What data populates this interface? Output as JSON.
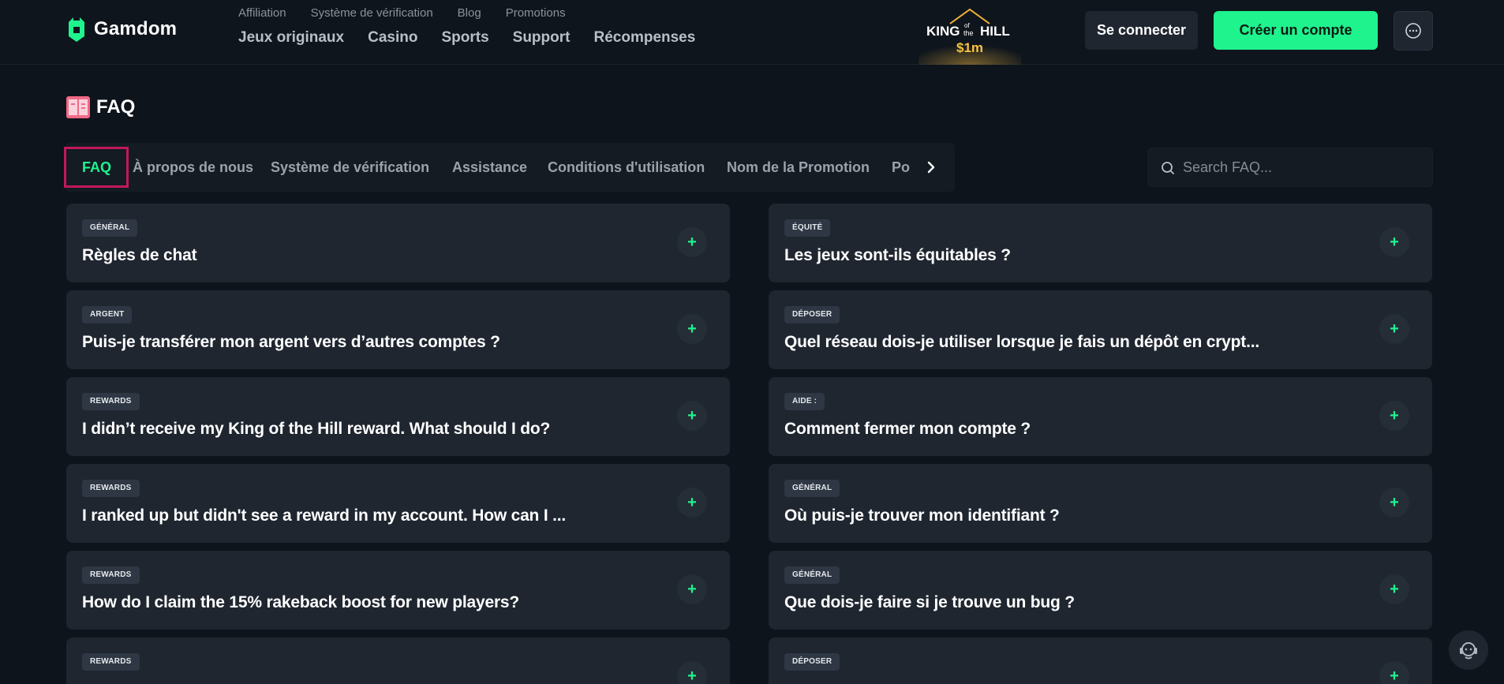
{
  "brand": {
    "name": "Gamdom",
    "accent": "#1ff38e"
  },
  "header": {
    "top_links": [
      "Affiliation",
      "Système de vérification",
      "Blog",
      "Promotions"
    ],
    "main_links": [
      "Jeux originaux",
      "Casino",
      "Sports",
      "Support",
      "Récompenses"
    ],
    "promo": {
      "line1_left": "KING",
      "line1_of": "of",
      "line1_the": "the",
      "line1_right": "HILL",
      "amount": "$1m"
    },
    "login_label": "Se connecter",
    "signup_label": "Créer un compte",
    "chat_icon": "chat-bubble-icon"
  },
  "page": {
    "title": "FAQ",
    "title_icon": "faq-book-icon"
  },
  "tabs": {
    "items": [
      "FAQ",
      "À propos de nous",
      "Système de vérification",
      "Assistance",
      "Conditions d'utilisation",
      "Nom de la Promotion",
      "Po"
    ],
    "active_index": 0,
    "next_icon": "chevron-right-icon"
  },
  "search": {
    "placeholder": "Search FAQ..."
  },
  "faq": {
    "left": [
      {
        "tag": "GÉNÉRAL",
        "question": "Règles de chat"
      },
      {
        "tag": "ARGENT",
        "question": "Puis-je transférer mon argent vers d’autres comptes ?"
      },
      {
        "tag": "REWARDS",
        "question": "I didn’t receive my King of the Hill reward. What should I do?"
      },
      {
        "tag": "REWARDS",
        "question": "I ranked up but didn't see a reward in my account. How can I ..."
      },
      {
        "tag": "REWARDS",
        "question": "How do I claim the 15% rakeback boost for new players?"
      },
      {
        "tag": "REWARDS",
        "question": ""
      }
    ],
    "right": [
      {
        "tag": "ÉQUITÉ",
        "question": "Les jeux sont-ils équitables ?"
      },
      {
        "tag": "DÉPOSER",
        "question": "Quel réseau dois-je utiliser lorsque je fais un dépôt en crypt..."
      },
      {
        "tag": "AIDE :",
        "question": "Comment fermer mon compte ?"
      },
      {
        "tag": "GÉNÉRAL",
        "question": "Où puis-je trouver mon identifiant ?"
      },
      {
        "tag": "GÉNÉRAL",
        "question": "Que dois-je faire si je trouve un bug ?"
      },
      {
        "tag": "DÉPOSER",
        "question": ""
      }
    ],
    "expand_icon": "plus-icon"
  },
  "support_fab_icon": "support-agent-icon"
}
